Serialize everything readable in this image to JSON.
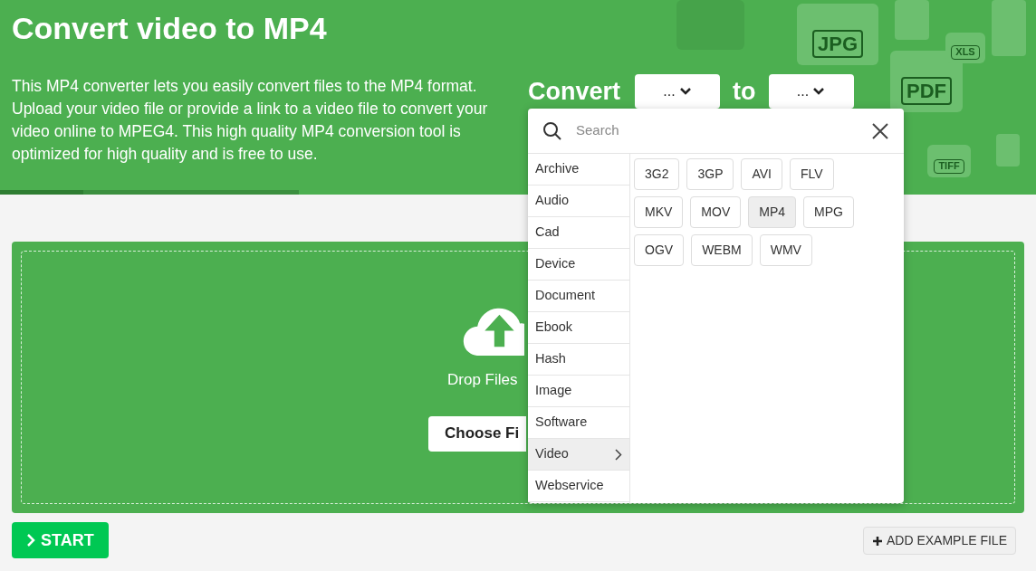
{
  "header": {
    "title": "Convert video to MP4",
    "description": "This MP4 converter lets you easily convert files to the MP4 format. Upload your video file or provide a link to a video file to convert your video online to MPEG4. This high quality MP4 conversion tool is optimized for high quality and is free to use.",
    "decor_labels": [
      "JPG",
      "PDF",
      "XLS",
      "TIFF"
    ]
  },
  "convert_bar": {
    "label": "Convert",
    "from_select": "...",
    "to_label": "to",
    "to_select": "..."
  },
  "dropdown": {
    "search_placeholder": "Search",
    "categories": [
      {
        "label": "Archive",
        "selected": false
      },
      {
        "label": "Audio",
        "selected": false
      },
      {
        "label": "Cad",
        "selected": false
      },
      {
        "label": "Device",
        "selected": false
      },
      {
        "label": "Document",
        "selected": false
      },
      {
        "label": "Ebook",
        "selected": false
      },
      {
        "label": "Hash",
        "selected": false
      },
      {
        "label": "Image",
        "selected": false
      },
      {
        "label": "Software",
        "selected": false
      },
      {
        "label": "Video",
        "selected": true
      },
      {
        "label": "Webservice",
        "selected": false
      }
    ],
    "formats": [
      {
        "label": "3G2",
        "selected": false
      },
      {
        "label": "3GP",
        "selected": false
      },
      {
        "label": "AVI",
        "selected": false
      },
      {
        "label": "FLV",
        "selected": false
      },
      {
        "label": "MKV",
        "selected": false
      },
      {
        "label": "MOV",
        "selected": false
      },
      {
        "label": "MP4",
        "selected": true
      },
      {
        "label": "MPG",
        "selected": false
      },
      {
        "label": "OGV",
        "selected": false
      },
      {
        "label": "WEBM",
        "selected": false
      },
      {
        "label": "WMV",
        "selected": false
      }
    ]
  },
  "upload": {
    "drop_text": "Drop Files",
    "choose_button": "Choose Fi"
  },
  "actions": {
    "start": "START",
    "add_example": "ADD EXAMPLE FILE"
  }
}
